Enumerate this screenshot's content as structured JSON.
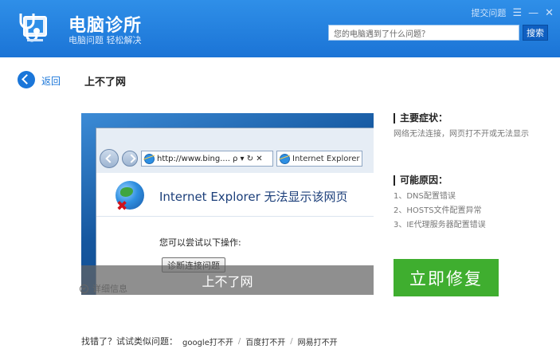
{
  "header": {
    "brand": "电脑诊所",
    "slogan": "电脑问题 轻松解决",
    "feedback": "提交问题",
    "search_placeholder": "您的电脑遇到了什么问题？",
    "search_button": "搜索"
  },
  "nav": {
    "back": "返回",
    "title": "上不了网"
  },
  "screenshot": {
    "address": "http://www.bing....",
    "address_tools": "ρ ▾ ↻ ✕",
    "tab": "Internet Explorer",
    "error_title": "Internet Explorer 无法显示该网页",
    "try": "您可以尝试以下操作:",
    "diag_button": "诊断连接问题",
    "caption": "上不了网",
    "details": "详细信息"
  },
  "symptoms": {
    "heading": "主要症状：",
    "text": "网络无法连接，网页打不开或无法显示"
  },
  "causes": {
    "heading": "可能原因：",
    "items": [
      "1、DNS配置错误",
      "2、HOSTS文件配置异常",
      "3、IE代理服务器配置错误"
    ]
  },
  "fix_button": "立即修复",
  "footer": {
    "question": "找错了？试试类似问题：",
    "links": [
      "google打不开",
      "百度打不开",
      "网易打不开"
    ]
  }
}
